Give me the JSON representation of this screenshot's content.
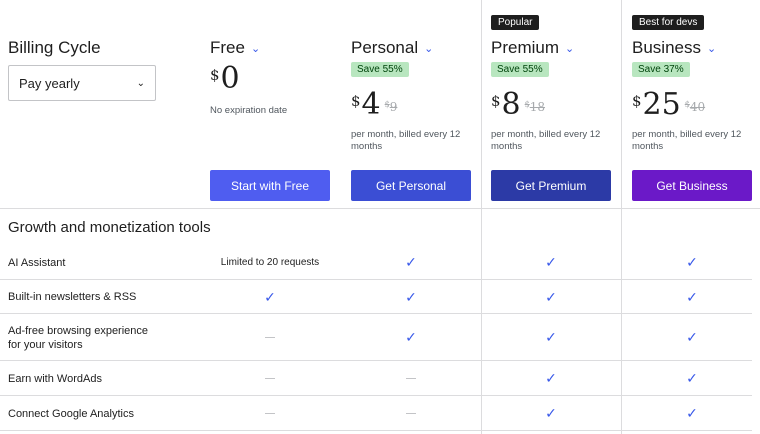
{
  "billing": {
    "title": "Billing Cycle",
    "select_value": "Pay yearly",
    "chevron_icon": "chevron-down-icon"
  },
  "plans": [
    {
      "key": "free",
      "name": "Free",
      "badge": "",
      "save": "",
      "currency": "$",
      "price": "0",
      "old_currency": "",
      "old_price": "",
      "note": "No expiration date",
      "cta": "Start with Free",
      "cta_color": "#4f5df0"
    },
    {
      "key": "personal",
      "name": "Personal",
      "badge": "",
      "save": "Save 55%",
      "currency": "$",
      "price": "4",
      "old_currency": "$",
      "old_price": "9",
      "note": "per month, billed every 12 months",
      "cta": "Get Personal",
      "cta_color": "#3b4ed4"
    },
    {
      "key": "premium",
      "name": "Premium",
      "badge": "Popular",
      "save": "Save 55%",
      "currency": "$",
      "price": "8",
      "old_currency": "$",
      "old_price": "18",
      "note": "per month, billed every 12 months",
      "cta": "Get Premium",
      "cta_color": "#2c3aa6"
    },
    {
      "key": "business",
      "name": "Business",
      "badge": "Best for devs",
      "save": "Save 37%",
      "currency": "$",
      "price": "25",
      "old_currency": "$",
      "old_price": "40",
      "note": "per month, billed every 12 months",
      "cta": "Get Business",
      "cta_color": "#6b19c8"
    }
  ],
  "section": {
    "title": "Growth and monetization tools"
  },
  "features": [
    {
      "label": "AI Assistant",
      "values": [
        "Limited to 20 requests",
        "check",
        "check",
        "check"
      ]
    },
    {
      "label": "Built-in newsletters & RSS",
      "values": [
        "check",
        "check",
        "check",
        "check"
      ]
    },
    {
      "label": "Ad-free browsing experience for your visitors",
      "values": [
        "dash",
        "check",
        "check",
        "check"
      ]
    },
    {
      "label": "Earn with WordAds",
      "values": [
        "dash",
        "dash",
        "check",
        "check"
      ]
    },
    {
      "label": "Connect Google Analytics",
      "values": [
        "dash",
        "dash",
        "check",
        "check"
      ]
    }
  ],
  "glyphs": {
    "check": "✓",
    "chevron": "⌄"
  },
  "colors": {
    "accent": "#3858e9",
    "save_bg": "#b8e6bf",
    "save_text": "#00450c",
    "badge_bg": "#1e1e1e"
  }
}
